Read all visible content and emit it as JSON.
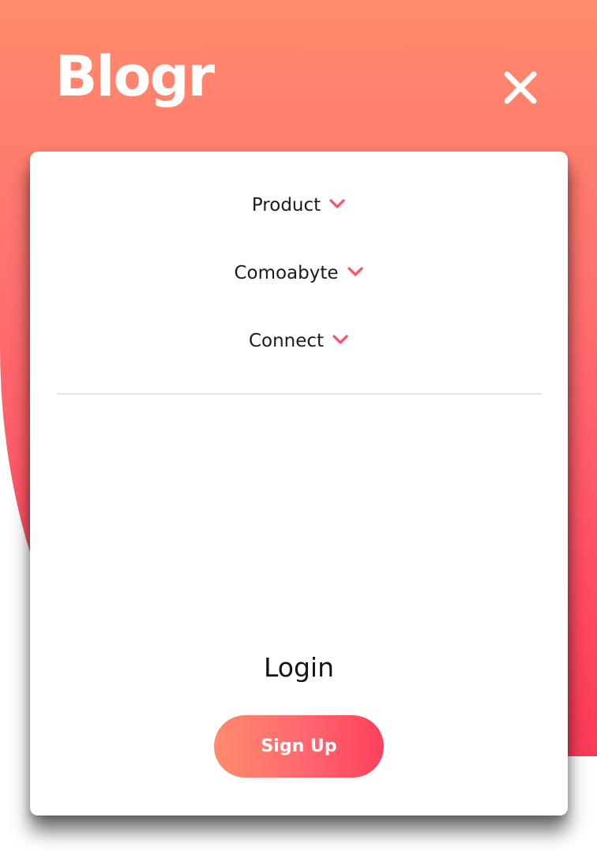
{
  "brand": {
    "logo_text": "Blogr"
  },
  "header": {
    "close_icon": "close-icon"
  },
  "menu": {
    "items": [
      {
        "label": "Product",
        "icon": "chevron-down-icon"
      },
      {
        "label": "Comoabyte",
        "icon": "chevron-down-icon"
      },
      {
        "label": "Connect",
        "icon": "chevron-down-icon"
      }
    ],
    "login_label": "Login",
    "signup_label": "Sign Up"
  },
  "colors": {
    "gradient_top": "#ff8b6c",
    "gradient_bottom": "#fd3a57",
    "chevron": "#ff525d",
    "text": "#1b1b1b"
  }
}
